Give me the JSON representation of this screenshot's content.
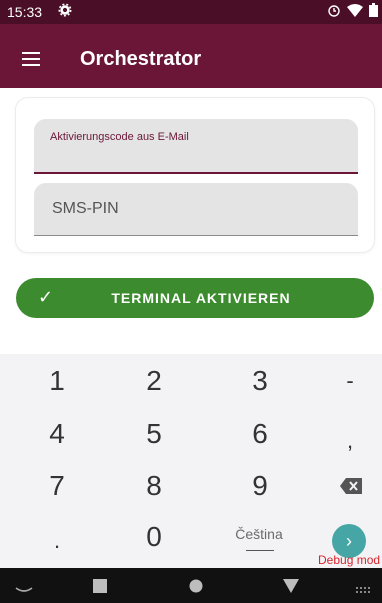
{
  "status_bar": {
    "time": "15:33"
  },
  "app_bar": {
    "title": "Orchestrator"
  },
  "form": {
    "activation_label": "Aktivierungscode aus E-Mail",
    "activation_value": "",
    "pin_placeholder": "SMS-PIN"
  },
  "activate_button": {
    "label": "TERMINAL AKTIVIEREN",
    "color": "#3c8c2f"
  },
  "keyboard": {
    "keys": [
      "1",
      "2",
      "3",
      "-",
      "4",
      "5",
      "6",
      ",",
      "7",
      "8",
      "9",
      ".",
      "0"
    ],
    "language": "Čeština",
    "go_key": "›"
  },
  "debug": {
    "label": "Debug mod"
  },
  "theme": {
    "primary": "#6b1637",
    "status_bar": "#4a0f26",
    "accent": "#46a6a6"
  }
}
